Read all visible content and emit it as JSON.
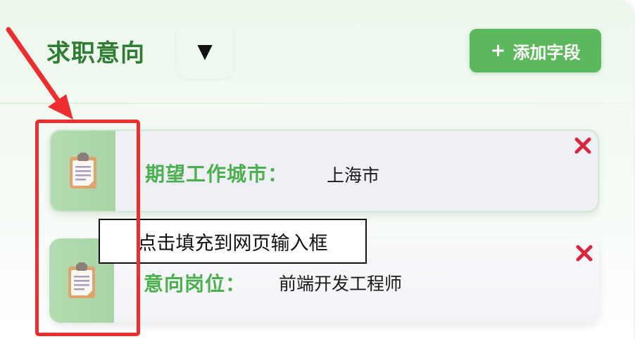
{
  "header": {
    "title": "求职意向",
    "toggle_icon": "caret-down-icon",
    "toggle_glyph": "▼",
    "add_button": {
      "icon": "plus-icon",
      "glyph": "+",
      "label": "添加字段"
    }
  },
  "fields": [
    {
      "label": "期望工作城市：",
      "value": "上海市",
      "icon": "clipboard-icon",
      "delete_icon": "close-icon"
    },
    {
      "label": "意向岗位：",
      "value": "前端开发工程师",
      "icon": "clipboard-icon",
      "delete_icon": "close-icon"
    }
  ],
  "tooltip": {
    "text": "点击填充到网页输入框"
  },
  "annotation": {
    "color": "#ee2e2e"
  },
  "colors": {
    "title": "#2f7d32",
    "accent": "#5cb85c",
    "label": "#4caf50",
    "handle": "#b5dcb2",
    "delete": "#d9263d"
  }
}
